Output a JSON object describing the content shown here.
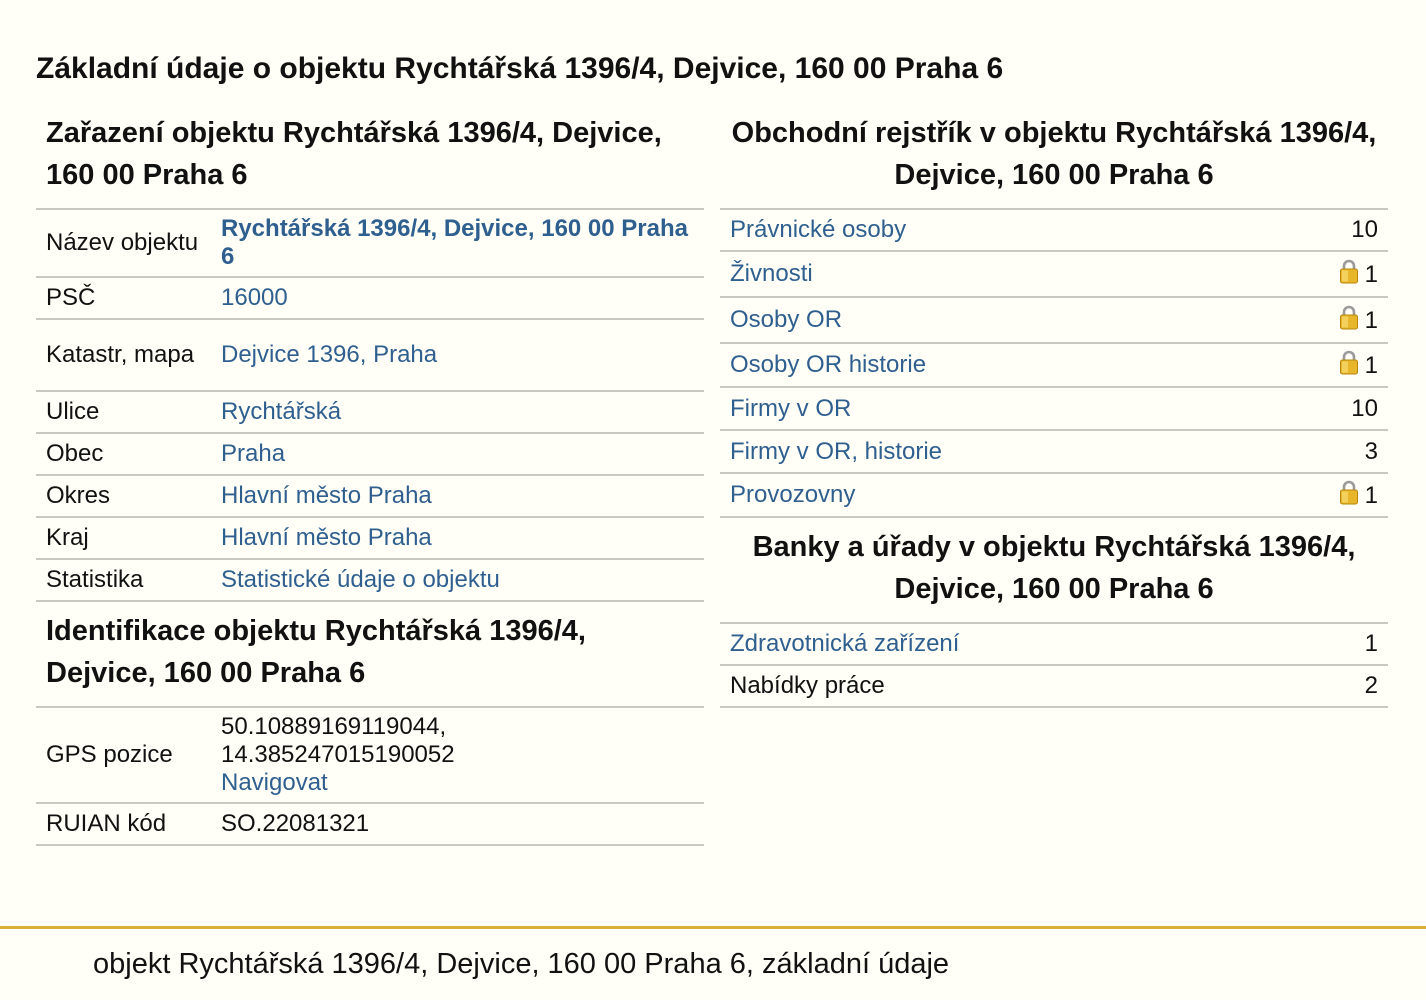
{
  "page_title": "Základní údaje o objektu Rychtářská 1396/4, Dejvice, 160 00 Praha 6",
  "zarazeni": {
    "title": "Zařazení objektu Rychtářská 1396/4, Dejvice, 160 00 Praha 6",
    "rows": [
      {
        "key": "Název objektu",
        "value": "Rychtářská 1396/4, Dejvice, 160 00 Praha 6"
      },
      {
        "key": "PSČ",
        "value": "16000"
      },
      {
        "key": "Katastr, mapa",
        "value": "Dejvice 1396, Praha"
      },
      {
        "key": "Ulice",
        "value": "Rychtářská"
      },
      {
        "key": "Obec",
        "value": "Praha"
      },
      {
        "key": "Okres",
        "value": "Hlavní město Praha"
      },
      {
        "key": "Kraj",
        "value": "Hlavní město Praha"
      },
      {
        "key": "Statistika",
        "value": "Statistické údaje o objektu"
      }
    ]
  },
  "identifikace": {
    "title": "Identifikace objektu Rychtářská 1396/4, Dejvice, 160 00 Praha 6",
    "gps_label": "GPS pozice",
    "gps_lat": "50.10889169119044,",
    "gps_lon": "14.385247015190052",
    "gps_link": "Navigovat",
    "ruian_label": "RUIAN kód",
    "ruian_value": "SO.22081321"
  },
  "obchodni": {
    "title": "Obchodní rejstřík v objektu Rychtářská 1396/4, Dejvice, 160 00 Praha 6",
    "rows": [
      {
        "label": "Právnické osoby",
        "count": "10",
        "locked": false
      },
      {
        "label": "Živnosti",
        "count": "1",
        "locked": true
      },
      {
        "label": "Osoby OR",
        "count": "1",
        "locked": true
      },
      {
        "label": "Osoby OR historie",
        "count": "1",
        "locked": true
      },
      {
        "label": "Firmy v OR",
        "count": "10",
        "locked": false
      },
      {
        "label": "Firmy v OR, historie",
        "count": "3",
        "locked": false
      },
      {
        "label": "Provozovny",
        "count": "1",
        "locked": true
      }
    ]
  },
  "banky": {
    "title": "Banky a úřady v objektu Rychtářská 1396/4, Dejvice, 160 00 Praha 6",
    "rows": [
      {
        "label": "Zdravotnická zařízení",
        "count": "1"
      },
      {
        "label": "Nabídky práce",
        "count": "2"
      }
    ]
  },
  "footer": {
    "text": "objekt Rychtářská 1396/4, Dejvice, 160 00 Praha 6, základní údaje"
  },
  "icons": {
    "lock": "padlock-icon"
  },
  "colors": {
    "link": "#2f5f8f",
    "footer_rule": "#d9b13a",
    "background": "#fffff7"
  }
}
